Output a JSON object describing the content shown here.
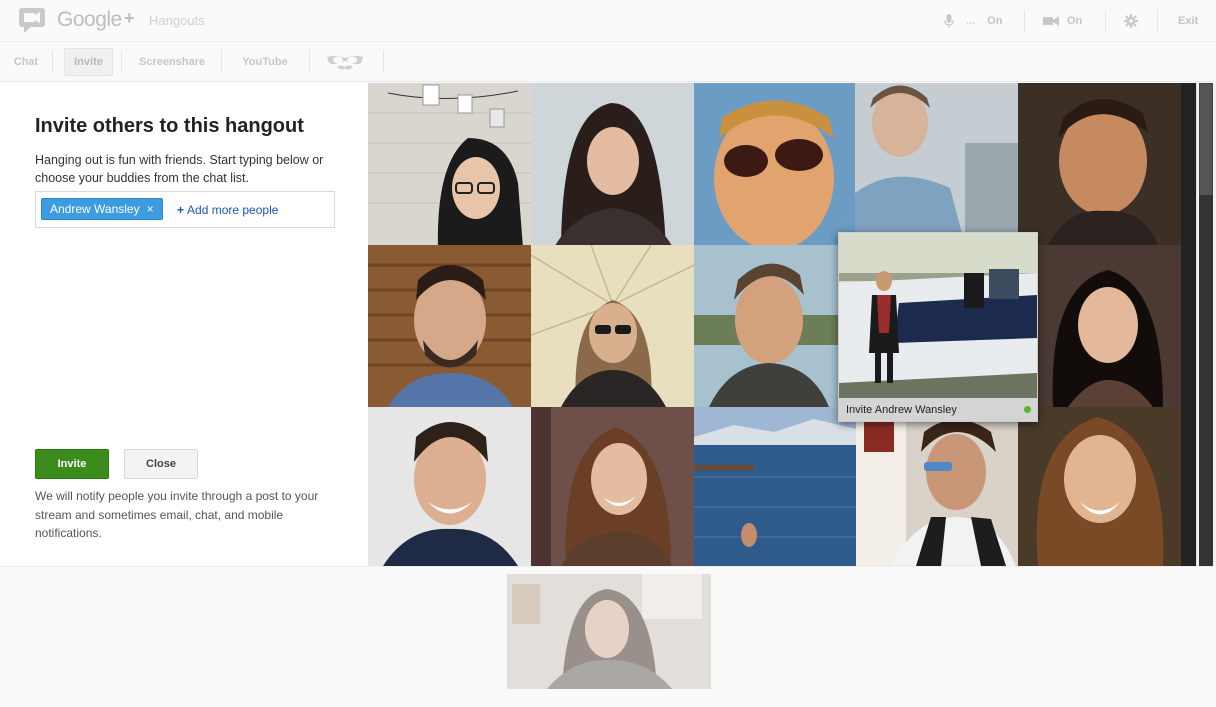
{
  "app": {
    "logo_text": "Google",
    "logo_plus": "+",
    "product": "Hangouts"
  },
  "controls": {
    "mic_dots": "...",
    "mic_state": "On",
    "camera_state": "On",
    "exit_label": "Exit"
  },
  "tabs": [
    {
      "label": "Chat",
      "active": false
    },
    {
      "label": "Invite",
      "active": true
    },
    {
      "label": "Screenshare",
      "active": false
    },
    {
      "label": "YouTube",
      "active": false
    }
  ],
  "invite": {
    "title": "Invite others to this hangout",
    "description": "Hanging out is fun with friends. Start typing below or choose your buddies from the chat list.",
    "selected_person": "Andrew Wansley",
    "chip_remove": "×",
    "add_more_plus": "+",
    "add_more": "Add more people",
    "invite_button": "Invite",
    "close_button": "Close",
    "notice": "We will notify people you invite through a post to your stream and sometimes email, chat, and mobile notifications."
  },
  "hover_card": {
    "label": "Invite Andrew Wansley",
    "status_color": "#5bb52b"
  },
  "colors": {
    "invite_green": "#3a8d1c",
    "chip_blue": "#3d9be0",
    "link_blue": "#1a55b5"
  }
}
